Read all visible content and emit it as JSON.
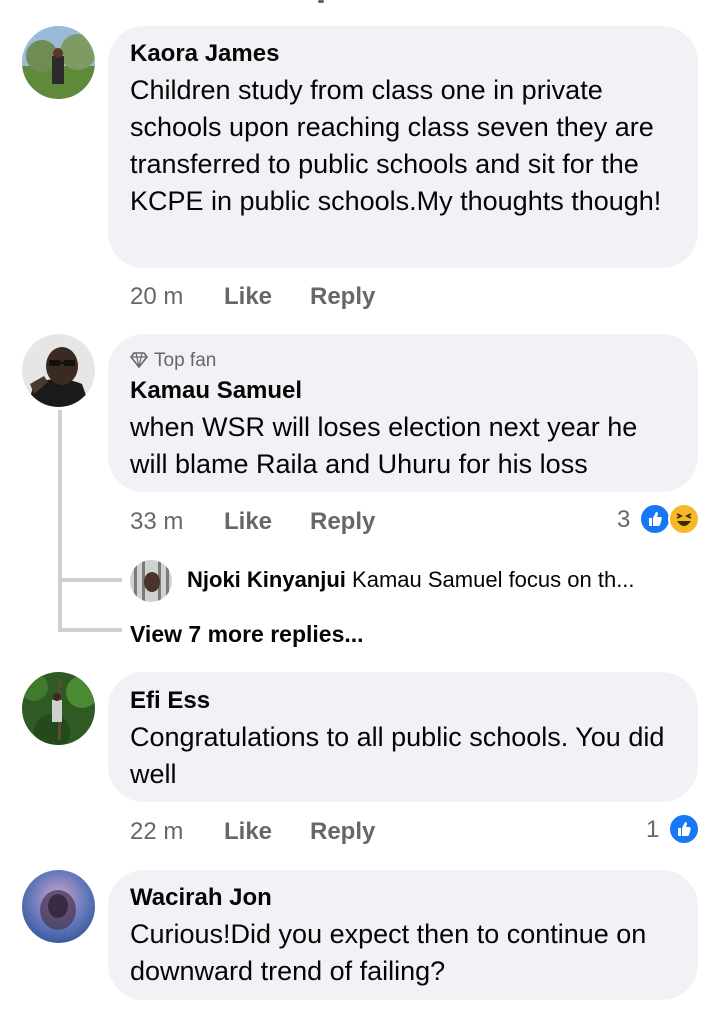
{
  "comments": [
    {
      "author": "Kaora James",
      "text": "Children study from class one in private schools upon reaching class seven they are transferred to public schools and sit for the KCPE in public schools.My thoughts though!",
      "time": "20 m",
      "like_label": "Like",
      "reply_label": "Reply"
    },
    {
      "badge": "Top fan",
      "author": "Kamau Samuel",
      "text": "when WSR will loses election next year he will blame Raila and Uhuru for his loss",
      "time": "33 m",
      "like_label": "Like",
      "reply_label": "Reply",
      "reaction_count": "3",
      "reactions": [
        "like-icon",
        "haha-icon"
      ],
      "reply_preview": {
        "author": "Njoki Kinyanjui",
        "text": "Kamau Samuel  focus on th..."
      },
      "view_more": "View 7 more replies..."
    },
    {
      "author": "Efi Ess",
      "text": "Congratulations to all public schools. You did well",
      "time": "22 m",
      "like_label": "Like",
      "reply_label": "Reply",
      "reaction_count": "1",
      "reactions": [
        "like-icon"
      ]
    },
    {
      "author": "Wacirah Jon",
      "text": "Curious!Did you expect then to continue on downward trend of failing?"
    }
  ],
  "colors": {
    "bubble": "#f0f2f5",
    "meta": "#65676b",
    "like_blue": "#1877f2",
    "haha_yellow": "#f7b928"
  }
}
